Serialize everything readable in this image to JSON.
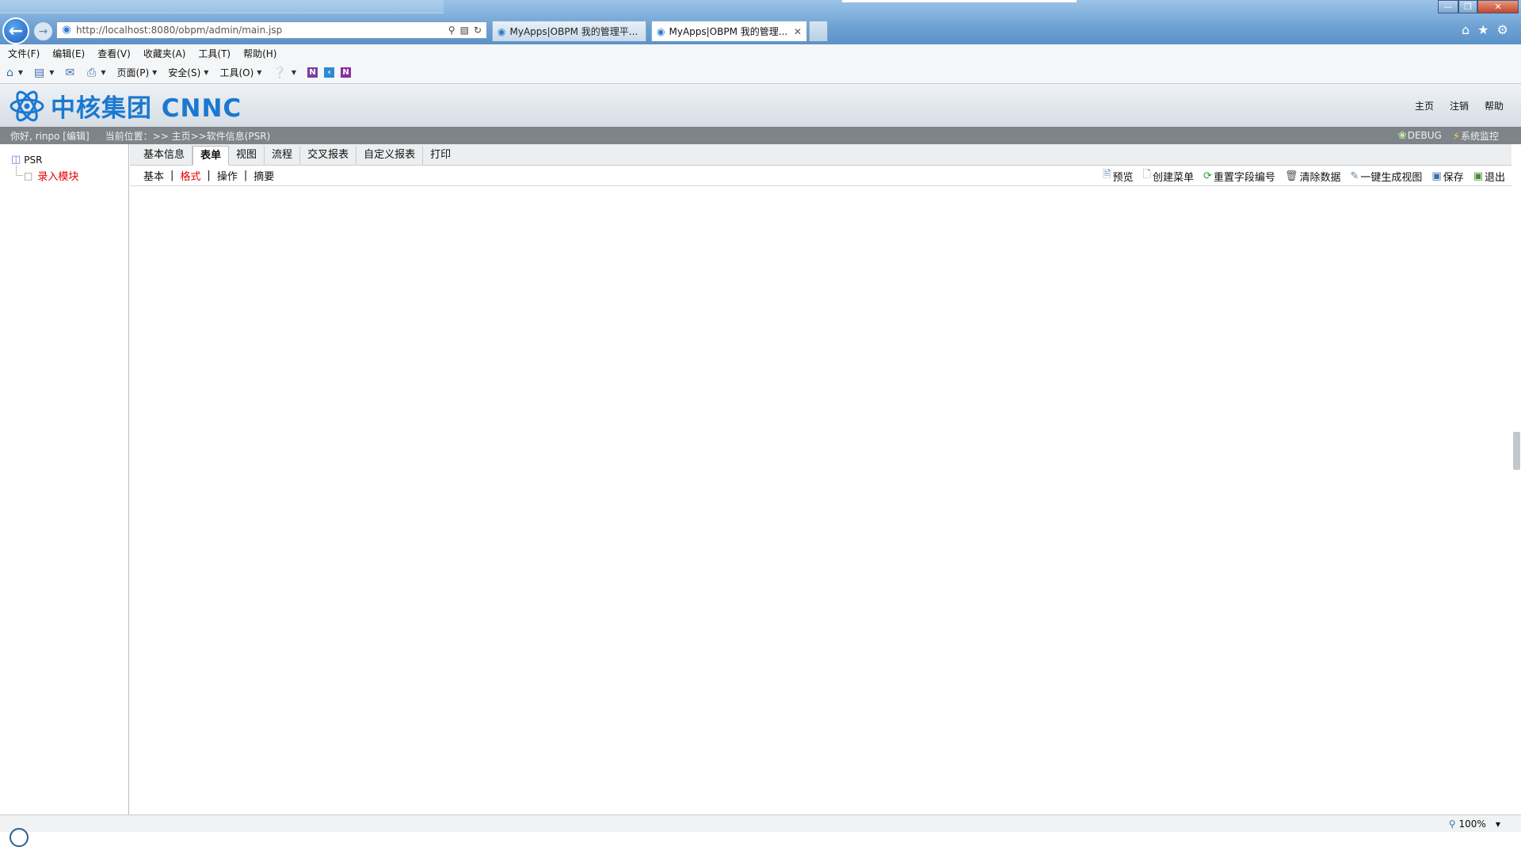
{
  "browser": {
    "address": "http://localhost:8080/obpm/admin/main.jsp",
    "tabs": [
      {
        "label": "MyApps|OBPM 我的管理平..."
      },
      {
        "label": "MyApps|OBPM 我的管理..."
      }
    ],
    "menu": [
      "文件(F)",
      "编辑(E)",
      "查看(V)",
      "收藏夹(A)",
      "工具(T)",
      "帮助(H)"
    ],
    "commands": {
      "page": "页面(P)",
      "safety": "安全(S)",
      "tools": "工具(O)"
    },
    "zoom": "100%"
  },
  "header": {
    "logo_text": "中核集团 CNNC",
    "links": [
      "主页",
      "注销",
      "帮助"
    ]
  },
  "status": {
    "greeting": "你好, rinpo [编辑]",
    "location": "当前位置：>> 主页>>软件信息(PSR)",
    "debug": "DEBUG",
    "monitor": "系统监控"
  },
  "tree": {
    "root": "PSR",
    "child": "录入模块"
  },
  "tabs": [
    "基本信息",
    "表单",
    "视图",
    "流程",
    "交叉报表",
    "自定义报表",
    "打印"
  ],
  "active_tab": "表单",
  "subtabs": [
    "基本",
    "格式",
    "操作",
    "摘要"
  ],
  "active_subtab": "格式",
  "actions": {
    "preview": "预览",
    "create_menu": "创建菜单",
    "reset_field": "重置字段编号",
    "clear_data": "清除数据",
    "gen_view": "一键生成视图",
    "save": "保存",
    "exit": "退出"
  },
  "colors": {
    "accent_blue": "#1a78d0",
    "active_red": "#e30000",
    "status_gray": "#7e848a"
  }
}
